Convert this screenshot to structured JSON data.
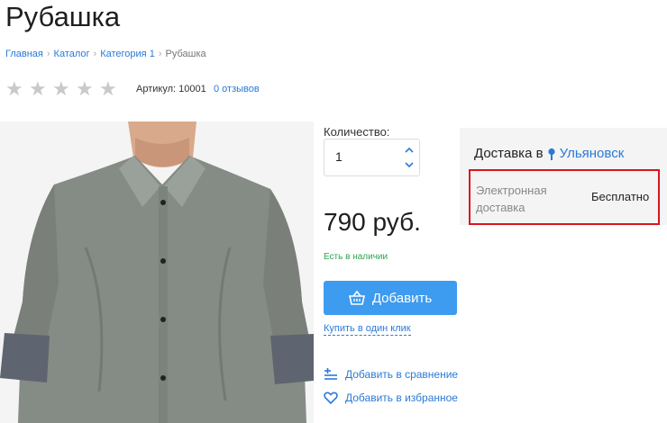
{
  "product": {
    "title": "Рубашка",
    "sku_text": "Артикул: 10001",
    "reviews_text": "0 отзывов",
    "rating": 0,
    "max_rating": 5
  },
  "breadcrumb": {
    "items": [
      "Главная",
      "Каталог",
      "Категория 1"
    ],
    "current": "Рубашка"
  },
  "purchase": {
    "quantity_label": "Количество:",
    "quantity_value": "1",
    "price": "790 руб.",
    "stock": "Есть в наличии",
    "add_label": "Добавить",
    "one_click_label": "Купить в один клик",
    "compare_label": "Добавить в сравнение",
    "favorite_label": "Добавить в избранное"
  },
  "delivery": {
    "heading": "Доставка в",
    "city": "Ульяновск",
    "method_name": "Электронная доставка",
    "method_price": "Бесплатно"
  },
  "colors": {
    "accent": "#3d9bf0",
    "link": "#2a7ad8",
    "stock": "#2ea44f",
    "highlight": "#d9151d"
  },
  "icons": {
    "pin": "map-pin-icon",
    "basket": "basket-icon",
    "compare": "compare-icon",
    "heart": "heart-icon",
    "star": "star-icon"
  }
}
